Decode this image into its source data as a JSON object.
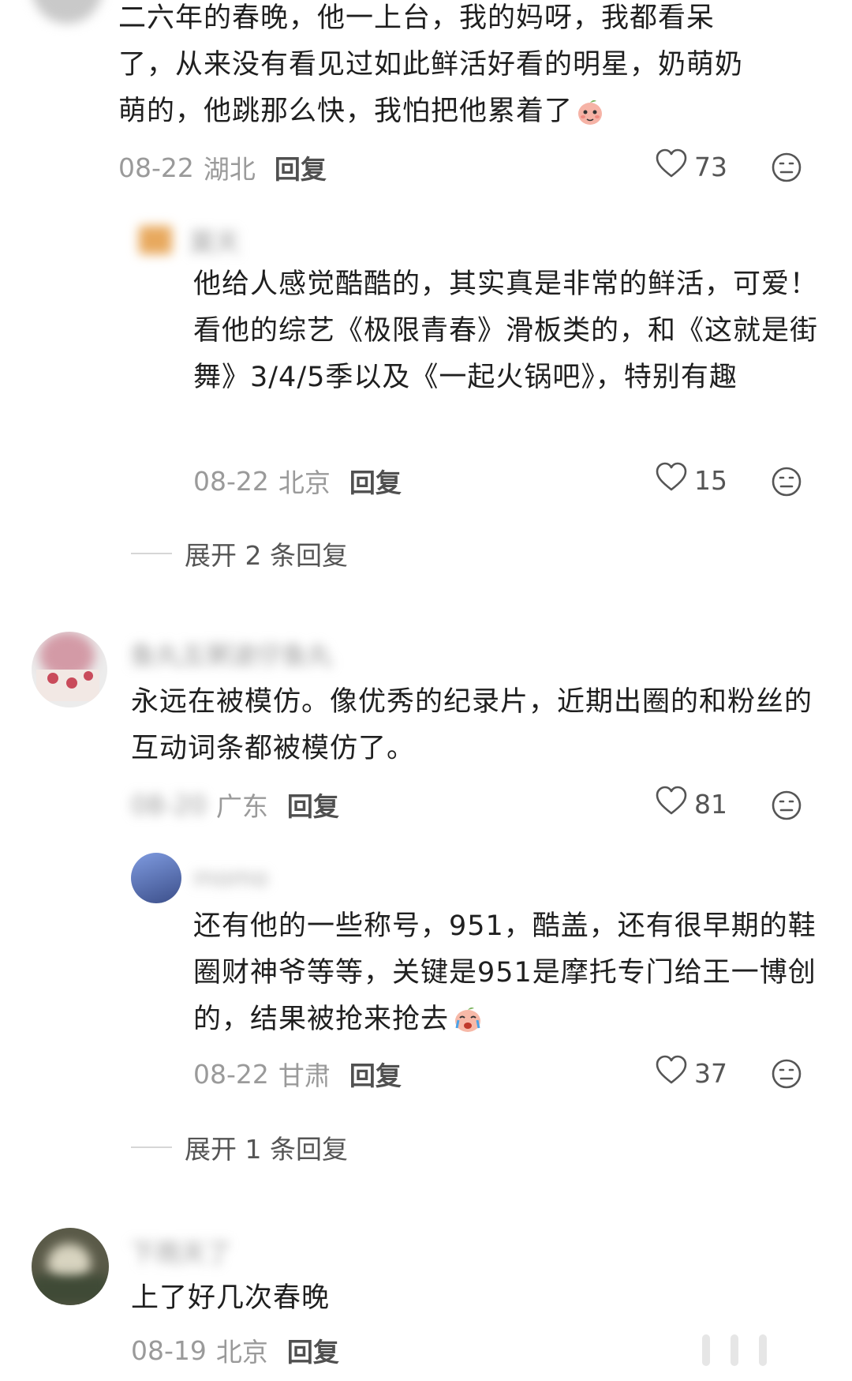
{
  "comments": [
    {
      "text": "二六年的春晚，他一上台，我的妈呀，我都看呆了，从来没有看见过如此鲜活好看的明星，奶萌奶萌的，他跳那么快，我怕把他累着了",
      "emoji": "peach-shy-emoji",
      "date": "08-22",
      "region": "湖北",
      "reply_label": "回复",
      "likes": "73"
    },
    {
      "user": "莫天",
      "text": "他给人感觉酷酷的，其实真是非常的鲜活，可爱！看他的综艺《极限青春》滑板类的，和《这就是街舞》3/4/5季以及《一起火锅吧》，特别有趣",
      "date": "08-22",
      "region": "北京",
      "reply_label": "回复",
      "likes": "15",
      "expand": "展开 2 条回复"
    },
    {
      "user": "鱼丸五粥波仔鱼丸",
      "text": "永远在被模仿。像优秀的纪录片，近期出圈的和粉丝的互动词条都被模仿了。",
      "date": "08-20",
      "region": "广东",
      "reply_label": "回复",
      "likes": "81"
    },
    {
      "user": "momo",
      "text": "还有他的一些称号，951，酷盖，还有很早期的鞋圈财神爷等等，关键是951是摩托专门给王一博创的，结果被抢来抢去",
      "emoji": "peach-cry-emoji",
      "date": "08-22",
      "region": "甘肃",
      "reply_label": "回复",
      "likes": "37",
      "expand": "展开 1 条回复"
    },
    {
      "user": "下雨天了",
      "text": "上了好几次春晚",
      "date": "08-19",
      "region": "北京",
      "reply_label": "回复"
    }
  ],
  "colors": {
    "text": "#1f1f1f",
    "meta": "#9a9a9a",
    "reply": "#505050"
  }
}
